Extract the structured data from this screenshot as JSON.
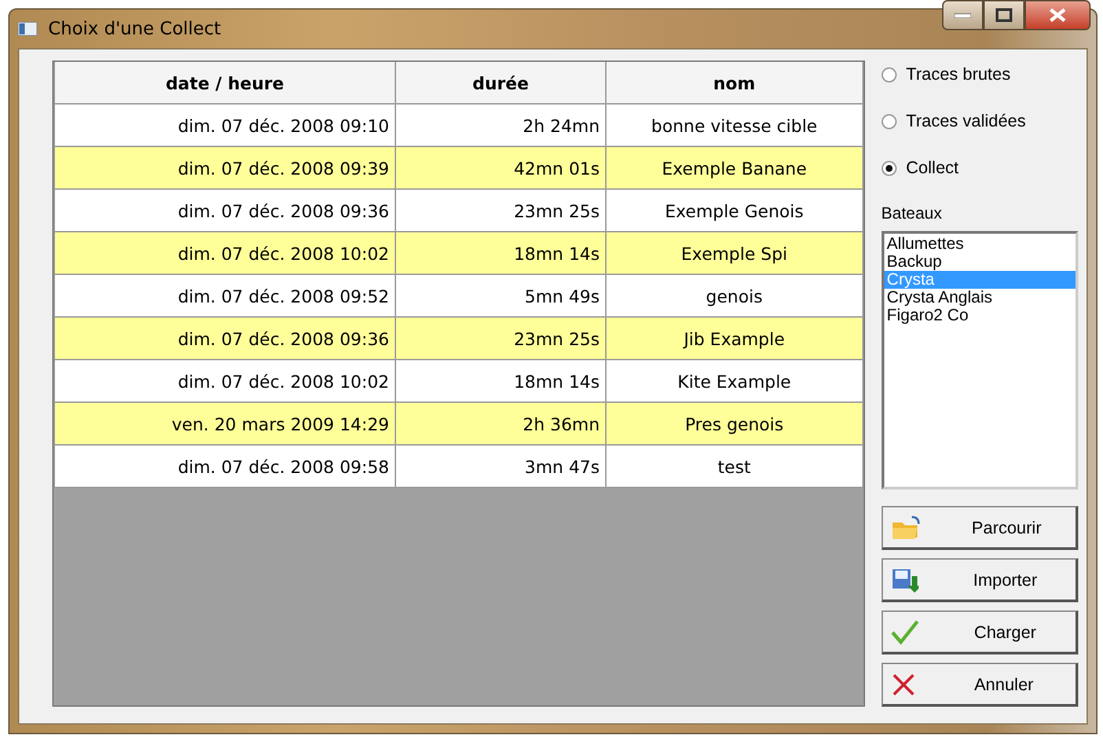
{
  "window": {
    "title": "Choix d'une Collect"
  },
  "table": {
    "columns": [
      "date / heure",
      "durée",
      "nom"
    ],
    "rows": [
      {
        "cells": [
          "dim. 07 déc. 2008 09:10",
          "2h 24mn",
          "bonne vitesse cible"
        ],
        "highlighted": false
      },
      {
        "cells": [
          "dim. 07 déc. 2008 09:39",
          "42mn 01s",
          "Exemple Banane"
        ],
        "highlighted": true
      },
      {
        "cells": [
          "dim. 07 déc. 2008 09:36",
          "23mn 25s",
          "Exemple Genois"
        ],
        "highlighted": false
      },
      {
        "cells": [
          "dim. 07 déc. 2008 10:02",
          "18mn 14s",
          "Exemple Spi"
        ],
        "highlighted": true
      },
      {
        "cells": [
          "dim. 07 déc. 2008 09:52",
          "5mn 49s",
          "genois"
        ],
        "highlighted": false
      },
      {
        "cells": [
          "dim. 07 déc. 2008 09:36",
          "23mn 25s",
          "Jib Example"
        ],
        "highlighted": true
      },
      {
        "cells": [
          "dim. 07 déc. 2008 10:02",
          "18mn 14s",
          "Kite Example"
        ],
        "highlighted": false
      },
      {
        "cells": [
          "ven. 20 mars 2009 14:29",
          "2h 36mn",
          "Pres genois"
        ],
        "highlighted": true
      },
      {
        "cells": [
          "dim. 07 déc. 2008 09:58",
          "3mn 47s",
          "test"
        ],
        "highlighted": false
      }
    ]
  },
  "source_options": [
    {
      "label": "Traces brutes",
      "selected": false
    },
    {
      "label": "Traces validées",
      "selected": false
    },
    {
      "label": "Collect",
      "selected": true
    }
  ],
  "boats": {
    "label": "Bateaux",
    "items": [
      {
        "label": "Allumettes",
        "selected": false
      },
      {
        "label": "Backup",
        "selected": false
      },
      {
        "label": "Crysta",
        "selected": true
      },
      {
        "label": "Crysta Anglais",
        "selected": false
      },
      {
        "label": "Figaro2 Co",
        "selected": false
      }
    ]
  },
  "buttons": [
    {
      "label": "Parcourir",
      "kind": "browse"
    },
    {
      "label": "Importer",
      "kind": "import"
    },
    {
      "label": "Charger",
      "kind": "load"
    },
    {
      "label": "Annuler",
      "kind": "cancel"
    }
  ]
}
